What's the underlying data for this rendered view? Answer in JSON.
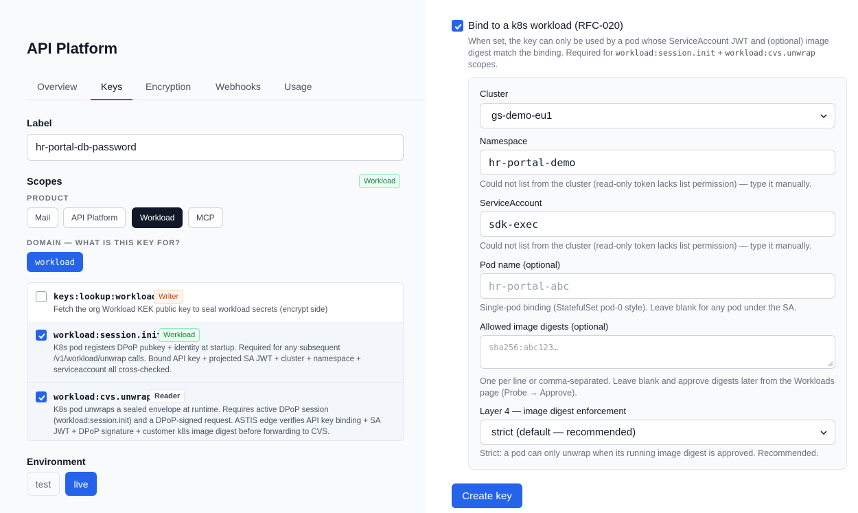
{
  "app": {
    "title": "API Platform"
  },
  "tabs": [
    {
      "label": "Overview"
    },
    {
      "label": "Keys"
    },
    {
      "label": "Encryption"
    },
    {
      "label": "Webhooks"
    },
    {
      "label": "Usage"
    }
  ],
  "active_tab": "Keys",
  "label_field": {
    "label": "Label",
    "value": "hr-portal-db-password"
  },
  "scopes": {
    "heading": "Scopes",
    "badge": "Workload",
    "product_caption": "PRODUCT",
    "products": [
      "Mail",
      "API Platform",
      "Workload",
      "MCP"
    ],
    "selected_product": "Workload",
    "domain_caption": "DOMAIN — WHAT IS THIS KEY FOR?",
    "domain_value": "workload",
    "items": [
      {
        "name": "keys:lookup:workload",
        "badge": "Writer",
        "checked": false,
        "desc": "Fetch the org Workload KEK public key to seal workload secrets (encrypt side)"
      },
      {
        "name": "workload:session.init",
        "badge": "Workload",
        "checked": true,
        "desc": "K8s pod registers DPoP pubkey + identity at startup. Required for any subsequent /v1/workload/unwrap calls. Bound API key + projected SA JWT + cluster + namespace + serviceaccount all cross-checked."
      },
      {
        "name": "workload:cvs.unwrap",
        "badge": "Reader",
        "checked": true,
        "desc": "K8s pod unwraps a sealed envelope at runtime. Requires active DPoP session (workload:session.init) and a DPoP-signed request. ASTIS edge verifies API key binding + SA JWT + DPoP signature + customer k8s image digest before forwarding to CVS."
      }
    ]
  },
  "environment": {
    "label": "Environment",
    "options": [
      "test",
      "live"
    ],
    "selected": "live"
  },
  "binding": {
    "checked": true,
    "title": "Bind to a k8s workload (RFC-020)",
    "desc_part1": "When set, the key can only be used by a pod whose ServiceAccount JWT and (optional) image digest match the binding. Required for ",
    "desc_code1": "workload:session.init",
    "desc_plus": " + ",
    "desc_code2": "workload:cvs.unwrap",
    "desc_part2": " scopes.",
    "cluster": {
      "label": "Cluster",
      "value": "gs-demo-eu1"
    },
    "namespace": {
      "label": "Namespace",
      "value": "hr-portal-demo",
      "help": "Could not list from the cluster (read-only token lacks list permission) — type it manually."
    },
    "service_account": {
      "label": "ServiceAccount",
      "value": "sdk-exec",
      "help": "Could not list from the cluster (read-only token lacks list permission) — type it manually."
    },
    "pod_name": {
      "label": "Pod name (optional)",
      "placeholder": "hr-portal-abc",
      "help": "Single-pod binding (StatefulSet pod-0 style). Leave blank for any pod under the SA."
    },
    "digests": {
      "label": "Allowed image digests (optional)",
      "placeholder": "sha256:abc123…",
      "help": "One per line or comma-separated. Leave blank and approve digests later from the Workloads page (Probe → Approve)."
    },
    "layer4": {
      "label": "Layer 4 — image digest enforcement",
      "value": "strict (default — recommended)",
      "help": "Strict: a pod can only unwrap when its running image digest is approved. Recommended."
    }
  },
  "create_button": "Create key",
  "colors": {
    "accent": "#2563eb",
    "dark": "#111827",
    "green": "#15803d",
    "orange": "#c2410c"
  }
}
